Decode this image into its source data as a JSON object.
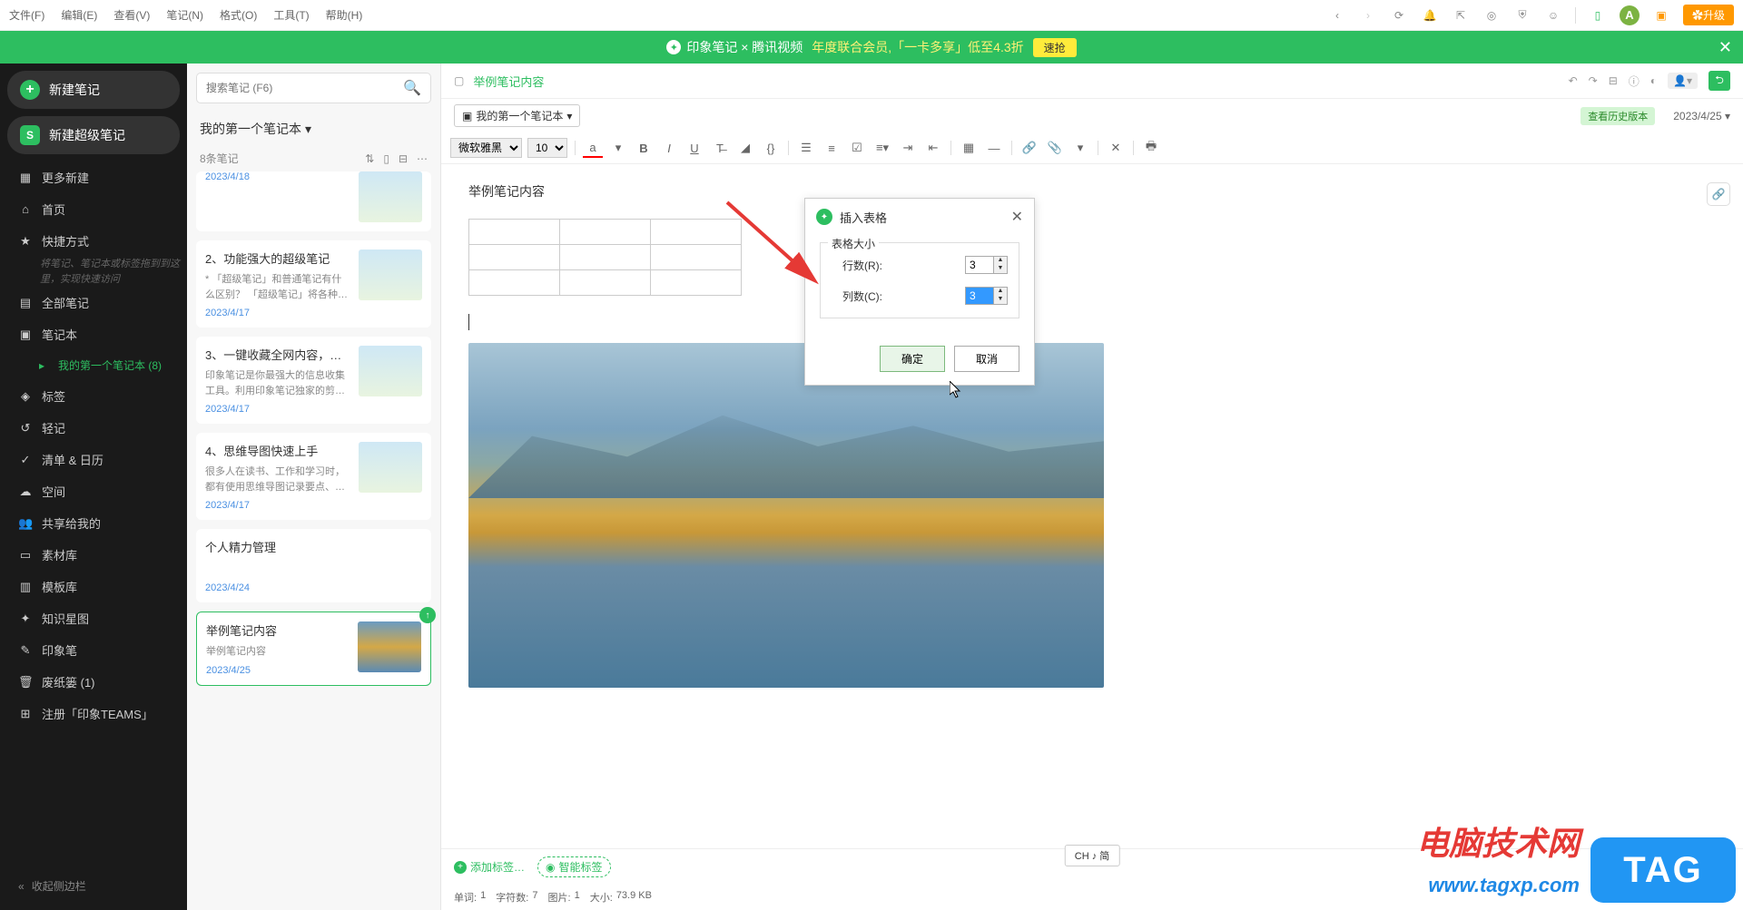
{
  "menubar": {
    "items": [
      "文件(F)",
      "编辑(E)",
      "查看(V)",
      "笔记(N)",
      "格式(O)",
      "工具(T)",
      "帮助(H)"
    ],
    "avatar_letter": "A",
    "upgrade": "✿升级"
  },
  "promo": {
    "brand": "印象笔记 × 腾讯视频",
    "text": "年度联合会员,「一卡多享」低至4.3折",
    "btn": "速抢"
  },
  "sidebar": {
    "new_note": "新建笔记",
    "new_super_note": "新建超级笔记",
    "items": [
      {
        "icon": "▦",
        "label": "更多新建"
      },
      {
        "icon": "⌂",
        "label": "首页"
      },
      {
        "icon": "★",
        "label": "快捷方式"
      },
      {
        "icon": "▤",
        "label": "全部笔记"
      },
      {
        "icon": "▣",
        "label": "笔记本"
      },
      {
        "icon": "◈",
        "label": "标签"
      },
      {
        "icon": "↺",
        "label": "轻记"
      },
      {
        "icon": "✓",
        "label": "清单 & 日历"
      },
      {
        "icon": "☁",
        "label": "空间"
      },
      {
        "icon": "👥",
        "label": "共享给我的"
      },
      {
        "icon": "▭",
        "label": "素材库"
      },
      {
        "icon": "▥",
        "label": "模板库"
      },
      {
        "icon": "✦",
        "label": "知识星图"
      },
      {
        "icon": "✎",
        "label": "印象笔"
      },
      {
        "icon": "🗑",
        "label": "废纸篓  (1)"
      },
      {
        "icon": "⊞",
        "label": "注册「印象TEAMS」"
      }
    ],
    "shortcut_hint": "将笔记、笔记本或标签拖到到这里，实现快速访问",
    "sub_notebook": "我的第一个笔记本  (8)",
    "collapse": "收起侧边栏"
  },
  "notelist": {
    "search_placeholder": "搜索笔记 (F6)",
    "notebook_title": "我的第一个笔记本",
    "count": "8条笔记",
    "notes": [
      {
        "title": "",
        "snippet": "",
        "date": "2023/4/18"
      },
      {
        "title": "2、功能强大的超级笔记",
        "snippet": "* 「超级笔记」和普通笔记有什么区别？ 「超级笔记」将各种…",
        "date": "2023/4/17"
      },
      {
        "title": "3、一键收藏全网内容，…",
        "snippet": "印象笔记是你最强大的信息收集工具。利用印象笔记独家的剪…",
        "date": "2023/4/17"
      },
      {
        "title": "4、思维导图快速上手",
        "snippet": "很多人在读书、工作和学习时，都有使用思维导图记录要点、…",
        "date": "2023/4/17"
      },
      {
        "title": "个人精力管理",
        "snippet": "",
        "date": "2023/4/24"
      },
      {
        "title": "举例笔记内容",
        "snippet": "举例笔记内容",
        "date": "2023/4/25"
      }
    ]
  },
  "editor": {
    "breadcrumb": "举例笔记内容",
    "notebook_btn": "我的第一个笔记本",
    "history_btn": "查看历史版本",
    "date": "2023/4/25",
    "font_family": "微软雅黑",
    "font_size": "10",
    "content_title": "举例笔记内容",
    "add_tag": "添加标签…",
    "smart_tag": "智能标签",
    "status": {
      "words_label": "单词:",
      "words": "1",
      "chars_label": "字符数:",
      "chars": "7",
      "images_label": "图片:",
      "images": "1",
      "size_label": "大小:",
      "size": "73.9 KB"
    },
    "ime": "CH ♪ 简"
  },
  "dialog": {
    "title": "插入表格",
    "section": "表格大小",
    "rows_label": "行数(R):",
    "rows_value": "3",
    "cols_label": "列数(C):",
    "cols_value": "3",
    "ok": "确定",
    "cancel": "取消"
  },
  "watermark": {
    "text": "电脑技术网",
    "url": "www.tagxp.com",
    "badge": "TAG"
  }
}
